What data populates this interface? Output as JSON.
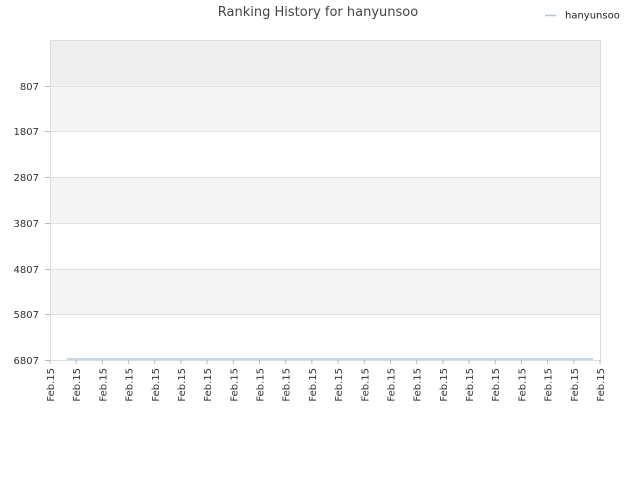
{
  "chart_data": {
    "type": "line",
    "title": "Ranking History for hanyunsoo",
    "xlabel": "",
    "ylabel": "",
    "y_inverted": true,
    "ylim": [
      -193,
      6807
    ],
    "yticks": [
      807,
      1807,
      2807,
      3807,
      4807,
      5807,
      6807
    ],
    "ytick_labels": [
      "807",
      "1807",
      "2807",
      "3807",
      "4807",
      "5807",
      "6807"
    ],
    "xtick_labels": [
      "Feb.15",
      "Feb.15",
      "Feb.15",
      "Feb.15",
      "Feb.15",
      "Feb.15",
      "Feb.15",
      "Feb.15",
      "Feb.15",
      "Feb.15",
      "Feb.15",
      "Feb.15",
      "Feb.15",
      "Feb.15",
      "Feb.15",
      "Feb.15",
      "Feb.15",
      "Feb.15",
      "Feb.15",
      "Feb.15",
      "Feb.15",
      "Feb.15"
    ],
    "grid": true,
    "legend_position": "top-right",
    "series": [
      {
        "name": "hanyunsoo",
        "color": "#aec7e8",
        "values": [
          6807,
          6807,
          6807,
          6807,
          6807,
          6807,
          6807,
          6807,
          6807,
          6807,
          6807,
          6807,
          6807,
          6807,
          6807,
          6807,
          6807,
          6807,
          6807,
          6807,
          6807
        ]
      }
    ],
    "band_colors": [
      "#eeeeee",
      "#f4f4f4",
      "#ffffff"
    ]
  }
}
